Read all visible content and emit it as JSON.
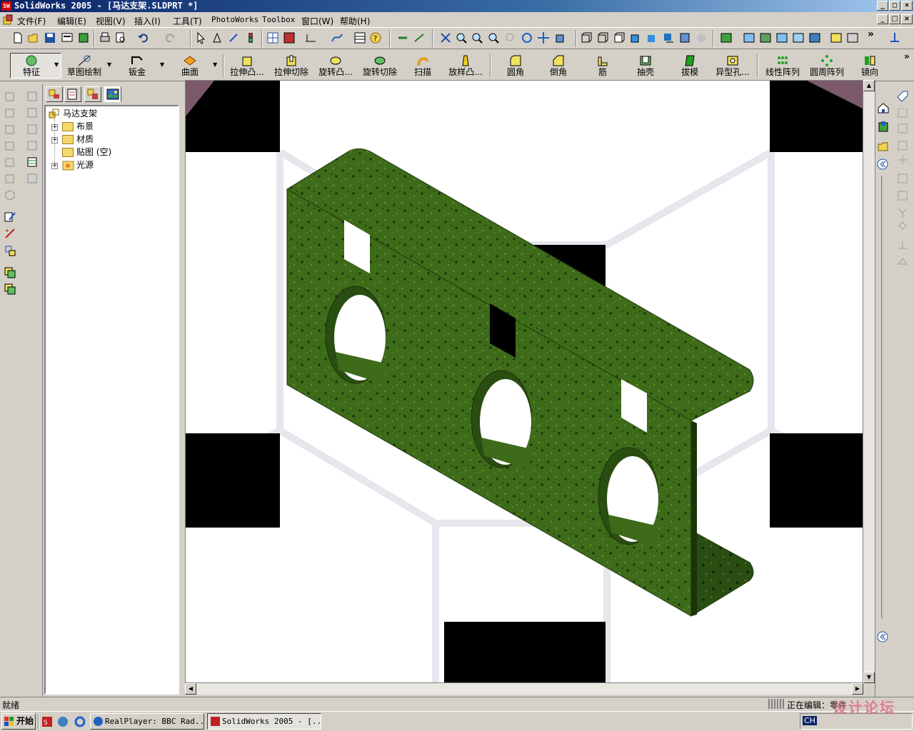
{
  "window": {
    "title": "SolidWorks 2005 - [马达支架.SLDPRT *]"
  },
  "menu": [
    "文件(F)",
    "编辑(E)",
    "视图(V)",
    "插入(I)",
    "工具(T)",
    "PhotoWorks",
    "Toolbox",
    "窗口(W)",
    "帮助(H)"
  ],
  "commands": [
    "特征",
    "草图绘制",
    "钣金",
    "曲面",
    "拉伸凸...",
    "拉伸切除",
    "旋转凸...",
    "旋转切除",
    "扫描",
    "放样凸...",
    "圆角",
    "倒角",
    "筋",
    "抽壳",
    "拔模",
    "异型孔...",
    "线性阵列",
    "圆周阵列",
    "镜向"
  ],
  "tree": {
    "root": "马达支架",
    "items": [
      {
        "label": "布景"
      },
      {
        "label": "材质"
      },
      {
        "label": "贴图 (空)"
      },
      {
        "label": "光源"
      }
    ]
  },
  "status": {
    "left": "就绪",
    "right": "正在编辑：零件"
  },
  "taskbar": {
    "start": "开始",
    "items": [
      "RealPlayer: BBC Rad...",
      "SolidWorks 2005 - [..."
    ],
    "tray": "CH"
  },
  "watermark": "设计论坛",
  "colors": {
    "titlebar": "#0a246a",
    "part": "#3d6b1a",
    "chrome": "#d4d0c8"
  }
}
